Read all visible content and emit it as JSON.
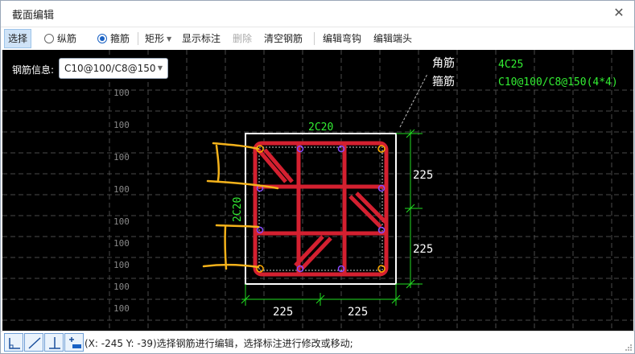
{
  "window": {
    "title": "截面编辑",
    "close_symbol": "✕"
  },
  "toolbar": {
    "select_label": "选择",
    "longitudinal_label": "纵筋",
    "stirrup_label": "箍筋",
    "shape_label": "矩形",
    "show_dims_label": "显示标注",
    "delete_label": "删除",
    "clear_label": "清空钢筋",
    "edit_hook_label": "编辑弯钩",
    "edit_end_label": "编辑端头",
    "selected_radio": "箍筋"
  },
  "rebar_info": {
    "label": "钢筋信息:",
    "selected": "C10@100/C8@150"
  },
  "canvas": {
    "grid_labels": [
      "100",
      "100",
      "100",
      "100",
      "100",
      "100",
      "100",
      "100",
      "100"
    ],
    "corner_label": "角筋",
    "stirrup_tag": "箍筋",
    "corner_value": "4C25",
    "stirrup_value": "C10@100/C8@150(4*4)",
    "top_bars": "2C20",
    "side_bars": "2C20",
    "dim_right_top": "225",
    "dim_right_bottom": "225",
    "dim_bottom_left": "225",
    "dim_bottom_right": "225"
  },
  "colors": {
    "background": "#000000",
    "rebar": "#d42030",
    "dimension": "#22dd22",
    "annotation_green": "#33ee33",
    "marker": "#ffaa00",
    "section_border": "#ffffff"
  },
  "statusbar": {
    "text": "(X: -245 Y: -39)选择钢筋进行编辑，选择标注进行修改或移动;",
    "icons": [
      "ortho-icon",
      "line-icon",
      "perpendicular-icon",
      "snap-icon"
    ]
  }
}
